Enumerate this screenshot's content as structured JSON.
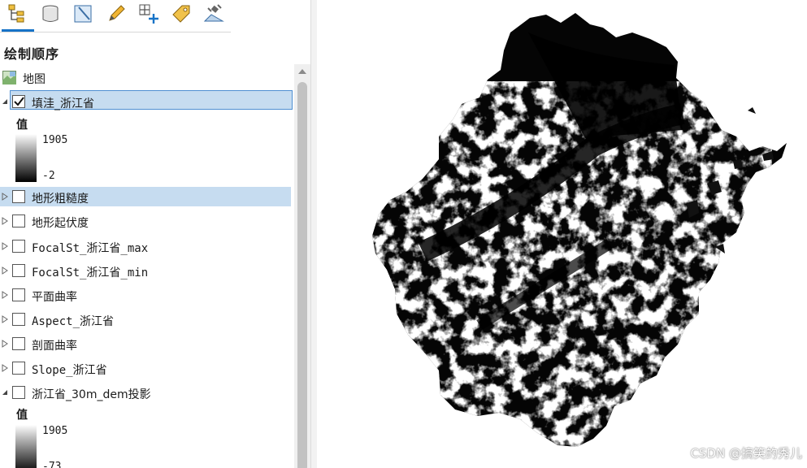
{
  "toolbar": {
    "tools": [
      {
        "name": "list-by-drawing-order-icon",
        "active": true
      },
      {
        "name": "list-by-source-icon"
      },
      {
        "name": "list-by-selection-icon"
      },
      {
        "name": "list-by-editing-icon"
      },
      {
        "name": "list-by-snapping-icon"
      },
      {
        "name": "list-by-labeling-icon"
      },
      {
        "name": "list-by-perspective-imagery-icon"
      }
    ]
  },
  "pane": {
    "title": "绘制顺序",
    "map_item": {
      "label": "地图",
      "icon": "map-icon"
    },
    "layers": [
      {
        "label": "填洼_浙江省",
        "checked": true,
        "expanded": true,
        "selected": true,
        "symbology": {
          "heading": "值",
          "high": "1905",
          "low": "-2"
        }
      },
      {
        "label": "地形粗糙度",
        "checked": false,
        "expanded": false,
        "hover": true
      },
      {
        "label": "地形起伏度",
        "checked": false,
        "expanded": false
      },
      {
        "label": "FocalSt_浙江省_max",
        "checked": false,
        "expanded": false
      },
      {
        "label": "FocalSt_浙江省_min",
        "checked": false,
        "expanded": false
      },
      {
        "label": "平面曲率",
        "checked": false,
        "expanded": false
      },
      {
        "label": "Aspect_浙江省",
        "checked": false,
        "expanded": false
      },
      {
        "label": "剖面曲率",
        "checked": false,
        "expanded": false
      },
      {
        "label": "Slope_浙江省",
        "checked": false,
        "expanded": false
      },
      {
        "label": "浙江省_30m_dem投影",
        "checked": false,
        "expanded": true,
        "symbology": {
          "heading": "值",
          "high": "1905",
          "low": "-73"
        }
      }
    ]
  },
  "map": {
    "watermark": "CSDN @搞笑的秀儿"
  },
  "colors": {
    "accent": "#1673c7",
    "selection": "#c6dcf0"
  }
}
